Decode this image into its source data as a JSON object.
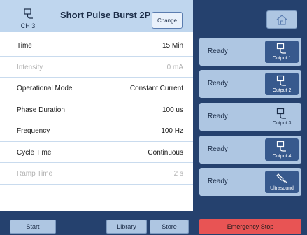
{
  "channel": {
    "label": "CH 3"
  },
  "program": {
    "title": "Short Pulse Burst 2P",
    "change_label": "Change"
  },
  "parameters": [
    {
      "label": "Time",
      "value": "15 Min",
      "enabled": true
    },
    {
      "label": "Intensity",
      "value": "0 mA",
      "enabled": false
    },
    {
      "label": "Operational Mode",
      "value": "Constant Current",
      "enabled": true
    },
    {
      "label": "Phase Duration",
      "value": "100 us",
      "enabled": true
    },
    {
      "label": "Frequency",
      "value": "100 Hz",
      "enabled": true
    },
    {
      "label": "Cycle Time",
      "value": "Continuous",
      "enabled": true
    },
    {
      "label": "Ramp Time",
      "value": "2 s",
      "enabled": false
    }
  ],
  "footer": {
    "start": "Start",
    "library": "Library",
    "store": "Store"
  },
  "outputs": [
    {
      "status": "Ready",
      "label": "Output 1",
      "icon": "electrode-icon",
      "selected": false
    },
    {
      "status": "Ready",
      "label": "Output 2",
      "icon": "electrode-icon",
      "selected": false
    },
    {
      "status": "Ready",
      "label": "Output 3",
      "icon": "electrode-icon",
      "selected": true
    },
    {
      "status": "Ready",
      "label": "Output 4",
      "icon": "electrode-icon",
      "selected": false
    },
    {
      "status": "Ready",
      "label": "Ultrasound",
      "icon": "ultrasound-probe-icon",
      "selected": false
    }
  ],
  "emergency_stop": "Emergency Stop",
  "colors": {
    "navy": "#25416e",
    "header": "#bfd6ee",
    "card": "#aec6e2",
    "button_dark": "#37598d",
    "emergency": "#e85454"
  }
}
